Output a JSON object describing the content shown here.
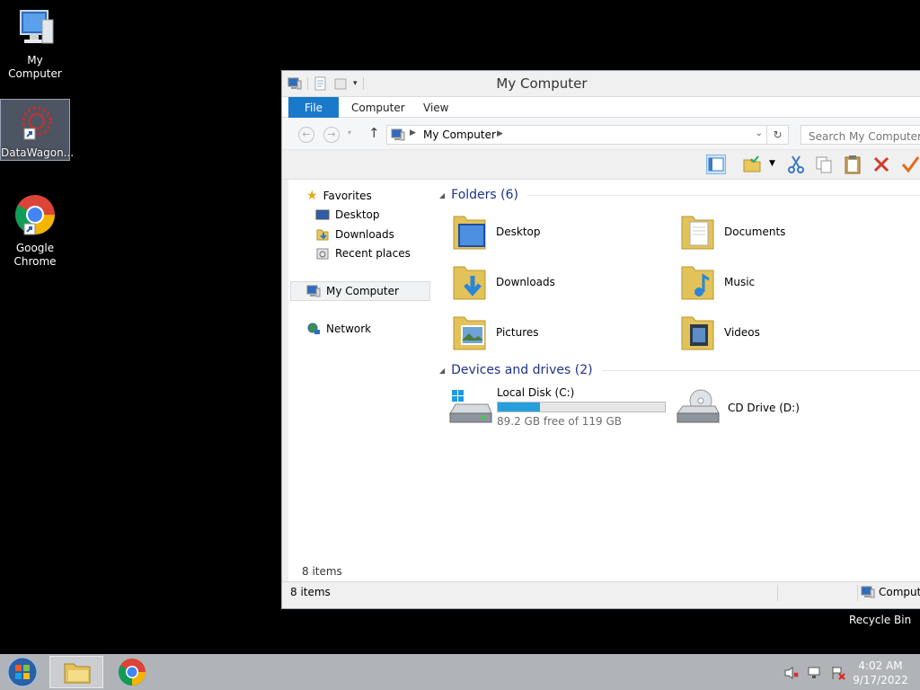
{
  "desktop": {
    "icons": [
      {
        "label": "My Computer",
        "icon": "computer-icon"
      },
      {
        "label": "DataWagon...",
        "icon": "datawagon-shortcut-icon"
      },
      {
        "label": "Google\nChrome",
        "icon": "chrome-icon"
      }
    ],
    "recycle_bin": "Recycle Bin"
  },
  "window": {
    "title": "My Computer",
    "tabs": [
      "File",
      "Computer",
      "View"
    ],
    "address": {
      "path": "My Computer"
    },
    "search": {
      "placeholder": "Search My Computer"
    },
    "navigation": {
      "favorites": "Favorites",
      "favorite_items": [
        "Desktop",
        "Downloads",
        "Recent places"
      ],
      "this_pc": "My Computer",
      "network": "Network"
    },
    "groups": {
      "folders_header": "Folders (6)",
      "folders": [
        "Desktop",
        "Documents",
        "Downloads",
        "Music",
        "Pictures",
        "Videos"
      ],
      "devices_header": "Devices and drives (2)",
      "local_disk": {
        "name": "Local Disk (C:)",
        "free_text": "89.2 GB free of 119 GB",
        "used_fraction": 0.25
      },
      "cd_drive": {
        "name": "CD Drive (D:)"
      }
    },
    "inner_count": "8 items",
    "status": {
      "count": "8 items",
      "location": "Computer"
    }
  },
  "taskbar": {
    "time": "4:02 AM",
    "date": "9/17/2022"
  },
  "colors": {
    "file_tab": "#1979ca",
    "accent_text": "#1e3287",
    "drive_fill": "#26a0da"
  }
}
